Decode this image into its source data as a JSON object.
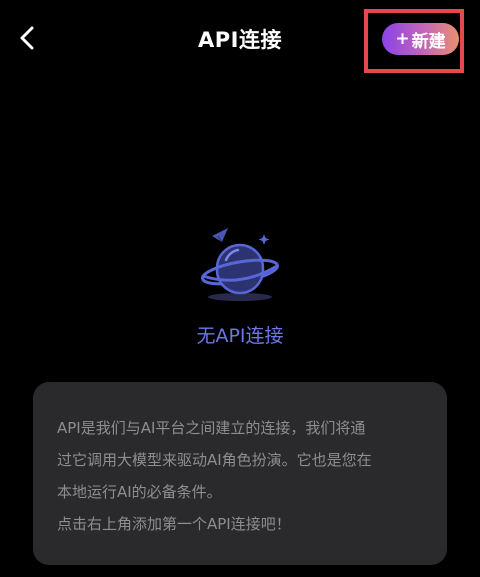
{
  "header": {
    "title": "API连接",
    "new_button_label": "新建",
    "new_button_plus": "+"
  },
  "empty_state": {
    "message": "无API连接"
  },
  "info_card": {
    "lines": [
      "API是我们与AI平台之间建立的连接，我们将通",
      "过它调用大模型来驱动AI角色扮演。它也是您在",
      "本地运行AI的必备条件。",
      "点击右上角添加第一个API连接吧！"
    ]
  },
  "colors": {
    "background": "#000000",
    "accent_empty_text": "#6b77e6",
    "new_button_gradient_start": "#8a43e8",
    "new_button_gradient_end": "#e8906e",
    "highlight_border": "#e5484d",
    "card_background": "#2a2a2c",
    "card_text": "#8d8d92"
  },
  "icons": {
    "back": "chevron-left-icon",
    "empty": "planet-icon",
    "add": "plus-icon"
  }
}
